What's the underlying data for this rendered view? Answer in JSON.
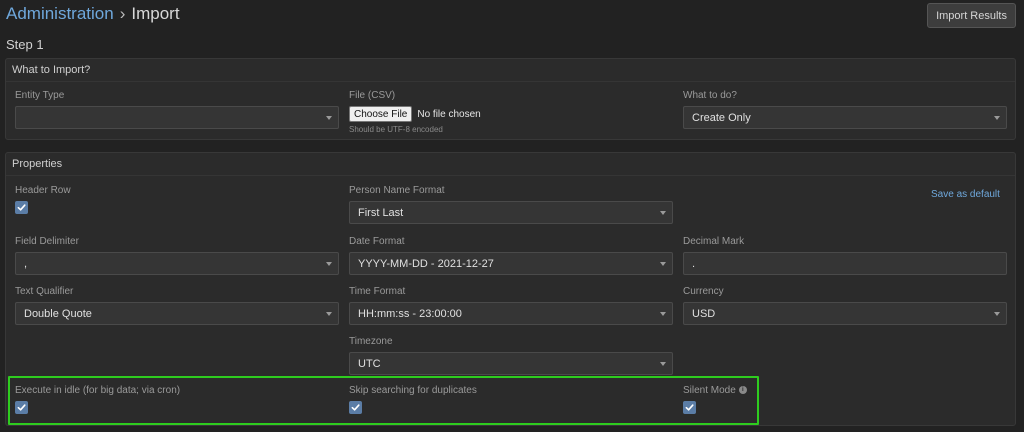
{
  "breadcrumb": {
    "parent": "Administration",
    "separator": "›",
    "current": "Import"
  },
  "import_results_button": "Import Results",
  "step_title": "Step 1",
  "what_to_import": {
    "heading": "What to Import?",
    "entity_type": {
      "label": "Entity Type",
      "value": ""
    },
    "file": {
      "label": "File (CSV)",
      "button": "Choose File",
      "status": "No file chosen",
      "hint": "Should be UTF-8 encoded"
    },
    "action": {
      "label": "What to do?",
      "value": "Create Only"
    }
  },
  "properties": {
    "heading": "Properties",
    "header_row": {
      "label": "Header Row",
      "checked": true
    },
    "person_name_format": {
      "label": "Person Name Format",
      "value": "First Last"
    },
    "save_as_default": "Save as default",
    "field_delimiter": {
      "label": "Field Delimiter",
      "value": ","
    },
    "date_format": {
      "label": "Date Format",
      "value": "YYYY-MM-DD - 2021-12-27"
    },
    "decimal_mark": {
      "label": "Decimal Mark",
      "value": "."
    },
    "text_qualifier": {
      "label": "Text Qualifier",
      "value": "Double Quote"
    },
    "time_format": {
      "label": "Time Format",
      "value": "HH:mm:ss - 23:00:00"
    },
    "currency": {
      "label": "Currency",
      "value": "USD"
    },
    "timezone": {
      "label": "Timezone",
      "value": "UTC"
    },
    "execute_in_idle": {
      "label": "Execute in idle (for big data; via cron)",
      "checked": true
    },
    "skip_duplicates": {
      "label": "Skip searching for duplicates",
      "checked": true
    },
    "silent_mode": {
      "label": "Silent Mode",
      "checked": true,
      "info_glyph": "i"
    }
  },
  "colors": {
    "background": "#222222",
    "panel": "#2b2b2b",
    "accent": "#6fa8dc",
    "checkbox": "#5b7da6",
    "highlight": "#2ecc1f"
  }
}
